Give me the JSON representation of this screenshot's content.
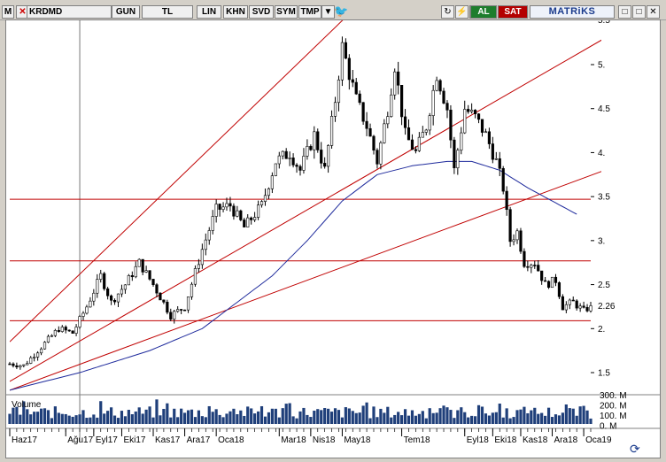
{
  "toolbar": {
    "m_label": "M",
    "symbol": "KRDMD",
    "period": "GUN",
    "currency": "TL",
    "scale_lin": "LIN",
    "btn_khn": "KHN",
    "btn_svd": "SVD",
    "btn_sym": "SYM",
    "btn_tmp": "TMP",
    "btn_al": "AL",
    "btn_sat": "SAT",
    "brand": "MATRiKS",
    "colors": {
      "al": "#1e7d2c",
      "sat": "#b40000",
      "brand": "#1a3b8c"
    }
  },
  "chart_data": {
    "type": "candlestick",
    "symbol": "KRDMD",
    "y_ticks": [
      "1.5",
      "2.",
      "2.5",
      "3.",
      "3.5",
      "4.",
      "4.5",
      "5."
    ],
    "y_top_tick_partial": "5.5",
    "last_price_label": "2.26",
    "last_price": 2.26,
    "x_labels": [
      {
        "label": "Haz17",
        "i": 0
      },
      {
        "label": "Ağu17",
        "i": 16
      },
      {
        "label": "Eyl17",
        "i": 24
      },
      {
        "label": "Eki17",
        "i": 32
      },
      {
        "label": "Kas17",
        "i": 41
      },
      {
        "label": "Ara17",
        "i": 50
      },
      {
        "label": "Oca18",
        "i": 59
      },
      {
        "label": "Mar18",
        "i": 77
      },
      {
        "label": "Nis18",
        "i": 86
      },
      {
        "label": "May18",
        "i": 95
      },
      {
        "label": "Tem18",
        "i": 112
      },
      {
        "label": "Eyl18",
        "i": 130
      },
      {
        "label": "Eki18",
        "i": 138
      },
      {
        "label": "Kas18",
        "i": 146
      },
      {
        "label": "Ara18",
        "i": 155
      },
      {
        "label": "Oca19",
        "i": 164
      }
    ],
    "close_anchors": [
      [
        0,
        1.6
      ],
      [
        4,
        1.58
      ],
      [
        8,
        1.75
      ],
      [
        14,
        2.0
      ],
      [
        18,
        1.95
      ],
      [
        22,
        2.25
      ],
      [
        26,
        2.6
      ],
      [
        29,
        2.3
      ],
      [
        33,
        2.5
      ],
      [
        37,
        2.75
      ],
      [
        41,
        2.5
      ],
      [
        46,
        2.15
      ],
      [
        50,
        2.25
      ],
      [
        55,
        2.9
      ],
      [
        59,
        3.35
      ],
      [
        63,
        3.4
      ],
      [
        67,
        3.15
      ],
      [
        72,
        3.4
      ],
      [
        76,
        3.9
      ],
      [
        80,
        4.0
      ],
      [
        83,
        3.8
      ],
      [
        87,
        4.2
      ],
      [
        90,
        3.8
      ],
      [
        93,
        4.6
      ],
      [
        95,
        5.2
      ],
      [
        97,
        4.9
      ],
      [
        99,
        4.6
      ],
      [
        102,
        4.3
      ],
      [
        105,
        3.9
      ],
      [
        108,
        4.5
      ],
      [
        110,
        5.0
      ],
      [
        113,
        4.2
      ],
      [
        116,
        4.0
      ],
      [
        119,
        4.3
      ],
      [
        122,
        4.9
      ],
      [
        125,
        4.5
      ],
      [
        127,
        3.8
      ],
      [
        130,
        4.5
      ],
      [
        133,
        4.4
      ],
      [
        136,
        4.2
      ],
      [
        139,
        3.9
      ],
      [
        141,
        3.6
      ],
      [
        143,
        3.0
      ],
      [
        145,
        3.1
      ],
      [
        147,
        2.75
      ],
      [
        150,
        2.75
      ],
      [
        153,
        2.5
      ],
      [
        156,
        2.55
      ],
      [
        158,
        2.25
      ],
      [
        161,
        2.3
      ],
      [
        164,
        2.2
      ],
      [
        166,
        2.26
      ]
    ],
    "moving_average_anchors": [
      [
        0,
        1.3
      ],
      [
        20,
        1.5
      ],
      [
        40,
        1.75
      ],
      [
        55,
        2.0
      ],
      [
        65,
        2.3
      ],
      [
        75,
        2.6
      ],
      [
        85,
        3.0
      ],
      [
        95,
        3.45
      ],
      [
        105,
        3.75
      ],
      [
        115,
        3.85
      ],
      [
        125,
        3.9
      ],
      [
        132,
        3.9
      ],
      [
        140,
        3.8
      ],
      [
        148,
        3.6
      ],
      [
        155,
        3.45
      ],
      [
        162,
        3.3
      ]
    ],
    "horizontal_lines": [
      3.47,
      2.77,
      2.09
    ],
    "trend_lines": [
      [
        [
          0,
          1.85
        ],
        [
          108,
          6.0
        ]
      ],
      [
        [
          0,
          1.4
        ],
        [
          170,
          5.3
        ]
      ],
      [
        [
          0,
          1.3
        ],
        [
          170,
          3.8
        ]
      ]
    ],
    "crosshair_i": 20,
    "volume_label": "Volume",
    "volume_ticks": [
      "300. M",
      "200. M",
      "100. M",
      "0. M"
    ],
    "colors": {
      "candle": "#000000",
      "moving_average": "#1e2a9c",
      "lines": "#c00000",
      "volume": "#1f3f7a"
    }
  }
}
